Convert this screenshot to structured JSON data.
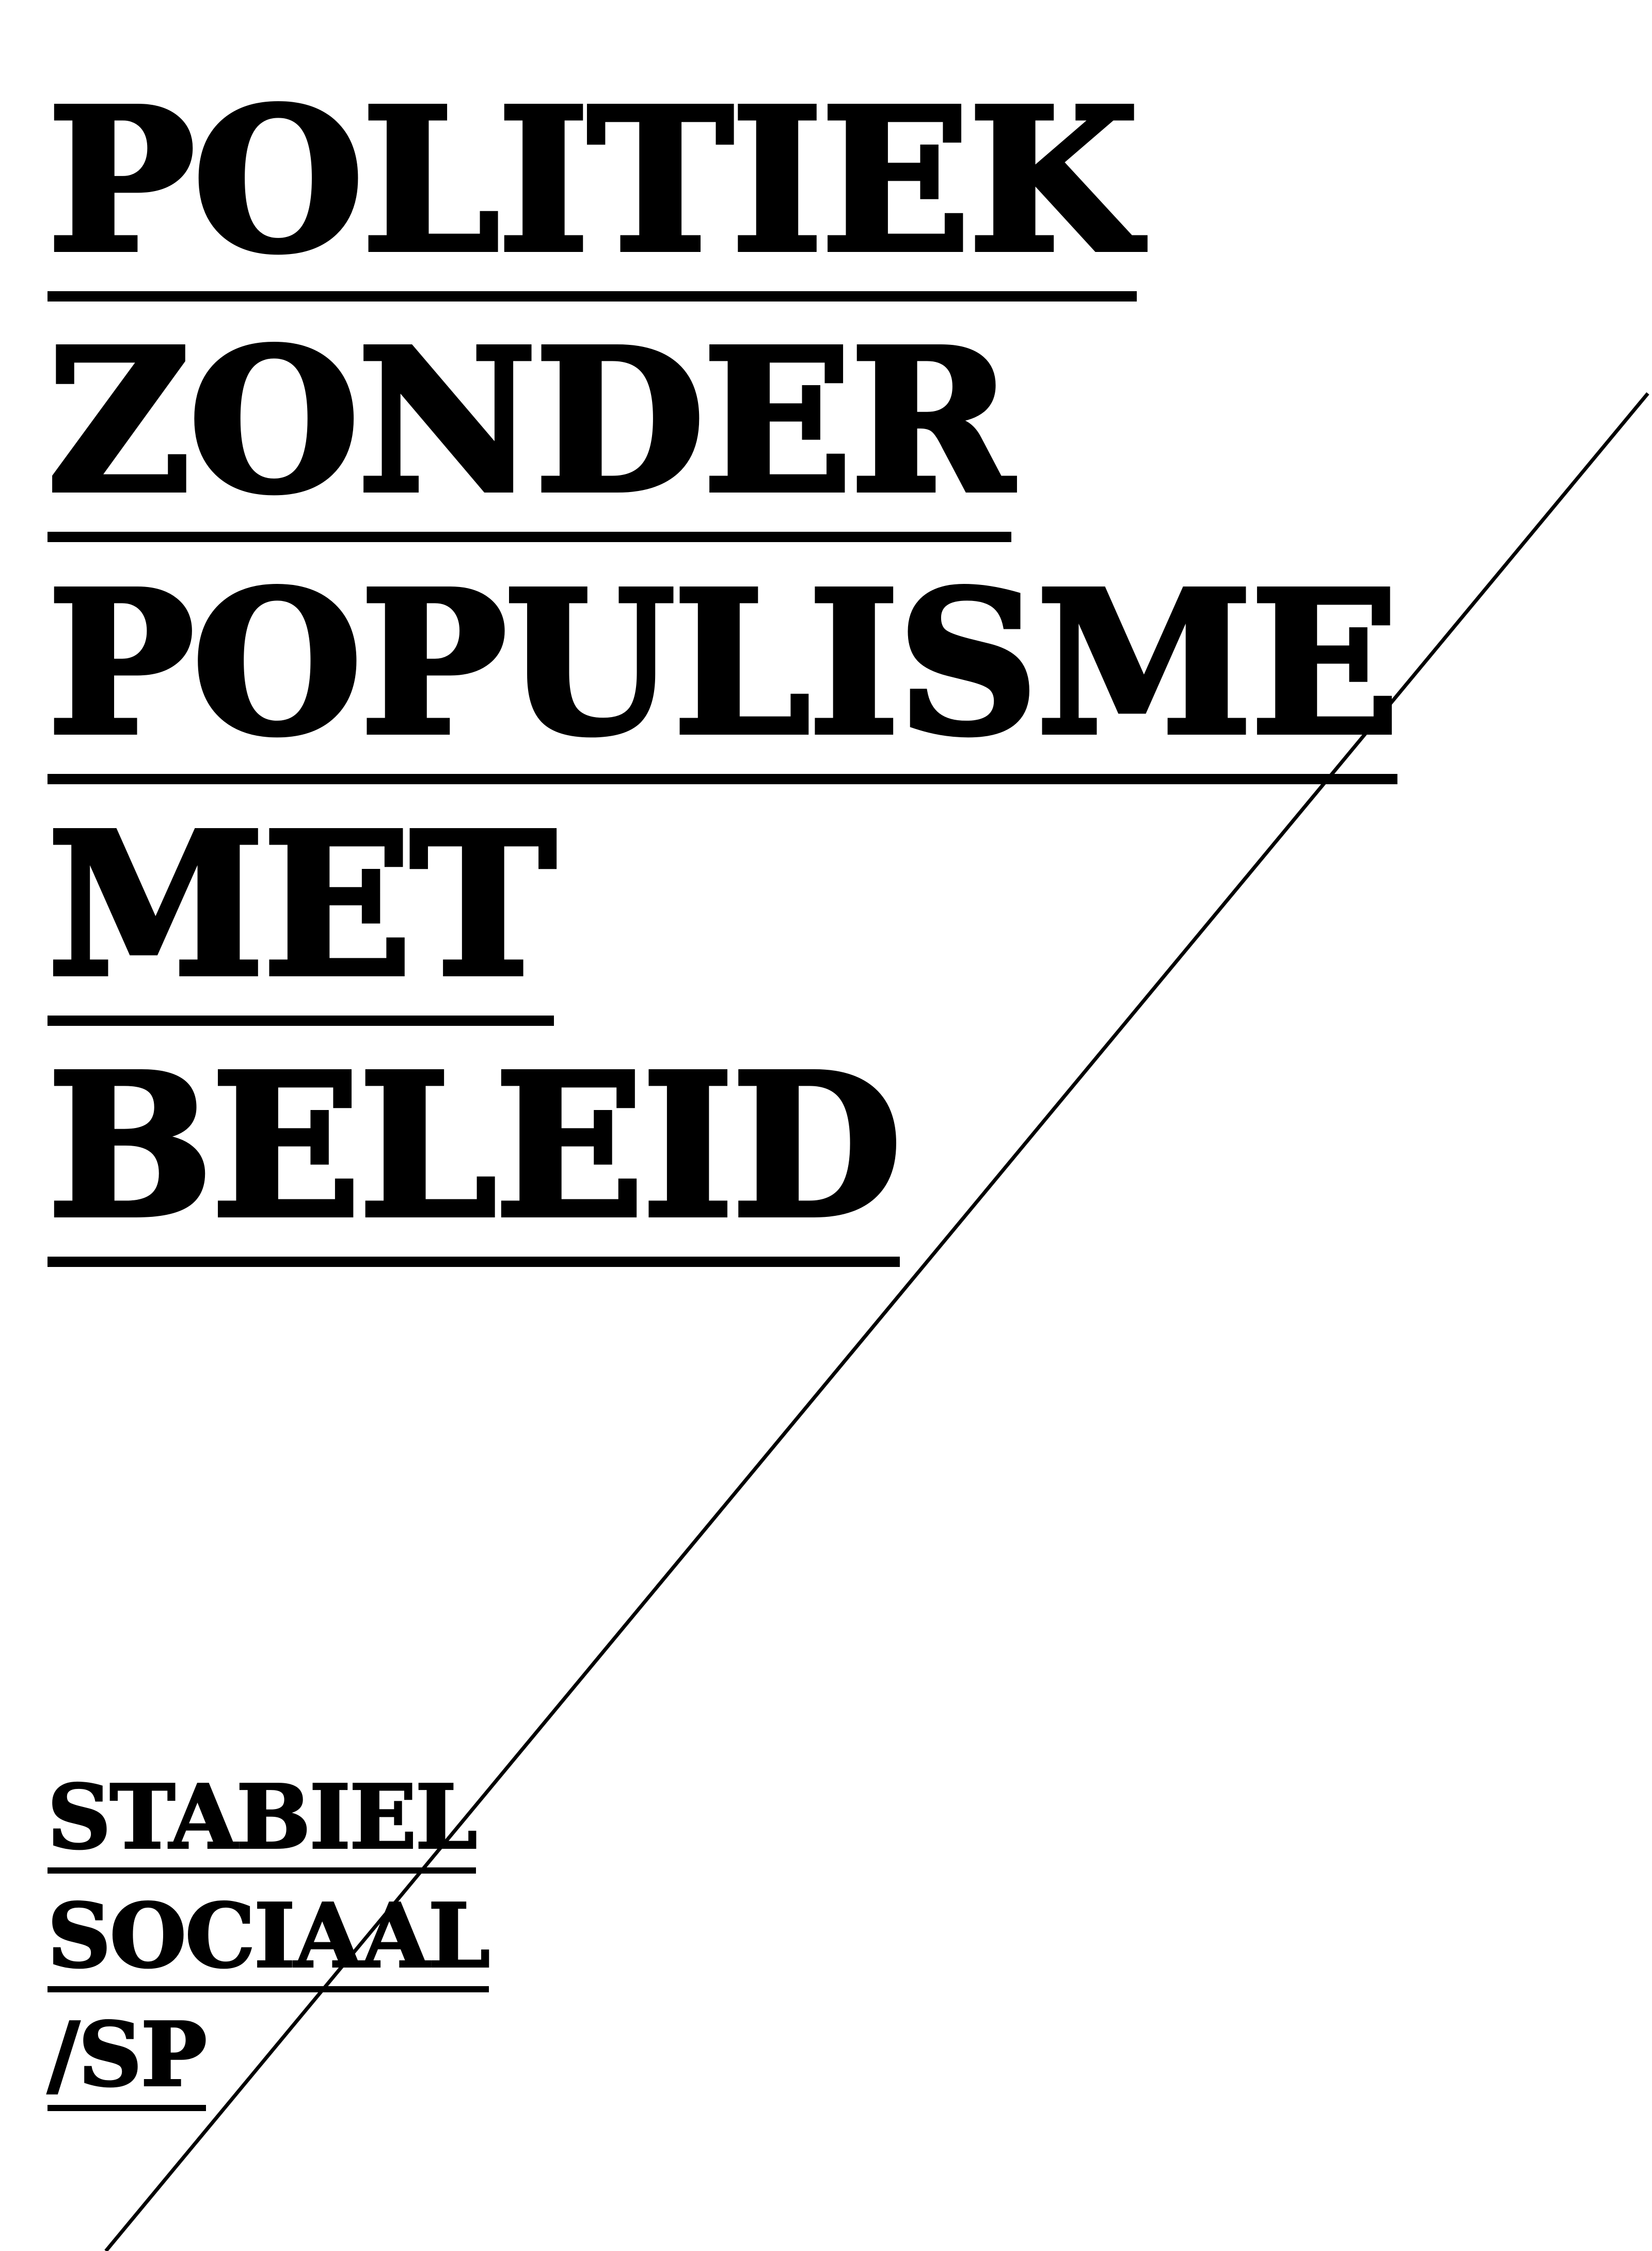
{
  "headline": {
    "lines": [
      "POLITIEK",
      "ZONDER",
      "POPULISME",
      "MET",
      "BELEID"
    ]
  },
  "tagline": {
    "lines": [
      "STABIEL",
      "SOCIAAL",
      "/SP"
    ]
  },
  "colors": {
    "ink": "#000000",
    "background": "#ffffff"
  }
}
